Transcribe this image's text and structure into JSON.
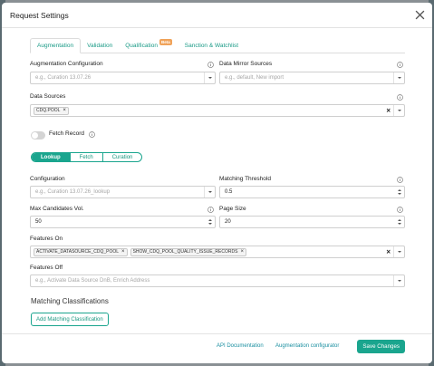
{
  "modal": {
    "title": "Request Settings"
  },
  "tabs": [
    {
      "label": "Augmentation"
    },
    {
      "label": "Validation"
    },
    {
      "label": "Qualification",
      "badge": "Beta"
    },
    {
      "label": "Sanction & Watchlist"
    }
  ],
  "augmentation_config": {
    "label": "Augmentation Configuration",
    "placeholder": "e.g., Curation 13.07.26"
  },
  "data_mirror": {
    "label": "Data Mirror Sources",
    "placeholder": "e.g., default, New import"
  },
  "data_sources": {
    "label": "Data Sources",
    "chips": [
      "CDQ.POOL"
    ]
  },
  "fetch_record": {
    "label": "Fetch Record",
    "enabled": false
  },
  "segments": [
    {
      "label": "Lookup",
      "selected": true
    },
    {
      "label": "Fetch"
    },
    {
      "label": "Curation"
    }
  ],
  "configuration": {
    "label": "Configuration",
    "placeholder": "e.g., Curation 13.07.26_lookup"
  },
  "matching_threshold": {
    "label": "Matching Threshold",
    "value": "0.5"
  },
  "max_candidates": {
    "label": "Max Candidates Vol.",
    "value": "50"
  },
  "page_size": {
    "label": "Page Size",
    "value": "20"
  },
  "features_on": {
    "label": "Features On",
    "chips": [
      "ACTIVATE_DATASOURCE_CDQ_POOL",
      "SHOW_CDQ_POOL_QUALITY_ISSUE_RECORDS"
    ]
  },
  "features_off": {
    "label": "Features Off",
    "placeholder": "e.g., Activate Data Source DnB, Enrich Address"
  },
  "matching_classifications": {
    "title": "Matching Classifications",
    "add_label": "Add Matching Classification"
  },
  "footer": {
    "api_docs": "API Documentation",
    "augmentation_configurator": "Augmentation configurator",
    "save": "Save Changes"
  },
  "colors": {
    "accent": "#1aa58e",
    "beta": "#f0a35a"
  }
}
